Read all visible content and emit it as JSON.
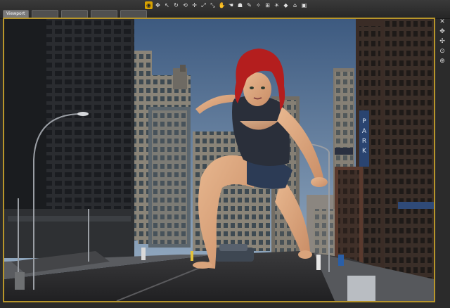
{
  "tabs": [
    {
      "label": "Viewport",
      "active": true
    },
    {
      "label": "",
      "active": false
    },
    {
      "label": "",
      "active": false
    },
    {
      "label": "",
      "active": false
    },
    {
      "label": "",
      "active": false
    }
  ],
  "toolbar": {
    "tools": [
      {
        "icon": "camera-select-icon",
        "glyph": "◉",
        "active": true
      },
      {
        "icon": "move-icon",
        "glyph": "✥"
      },
      {
        "icon": "pointer-icon",
        "glyph": "↖"
      },
      {
        "icon": "rotate-icon",
        "glyph": "↻"
      },
      {
        "icon": "orbit-icon",
        "glyph": "⟲"
      },
      {
        "icon": "translate-icon",
        "glyph": "✛"
      },
      {
        "icon": "scale-icon",
        "glyph": "⤢"
      },
      {
        "icon": "twist-icon",
        "glyph": "⤡"
      },
      {
        "icon": "hand-icon",
        "glyph": "✋"
      },
      {
        "icon": "grab-icon",
        "glyph": "☚"
      },
      {
        "icon": "figure-icon",
        "glyph": "☗"
      },
      {
        "icon": "brush-icon",
        "glyph": "✎"
      },
      {
        "icon": "morph-icon",
        "glyph": "✧"
      },
      {
        "icon": "node-icon",
        "glyph": "⊞"
      },
      {
        "icon": "light-icon",
        "glyph": "☀"
      },
      {
        "icon": "material-icon",
        "glyph": "◆"
      },
      {
        "icon": "render-icon",
        "glyph": "⌂"
      },
      {
        "icon": "snapshot-icon",
        "glyph": "▣"
      }
    ]
  },
  "sidetools": [
    {
      "icon": "close-icon",
      "glyph": "✕"
    },
    {
      "icon": "pan-icon",
      "glyph": "✥"
    },
    {
      "icon": "orbit-view-icon",
      "glyph": "✣"
    },
    {
      "icon": "zoom-icon",
      "glyph": "⊙"
    },
    {
      "icon": "frame-icon",
      "glyph": "⊕"
    }
  ],
  "scene": {
    "sign_text": "PARK",
    "colors": {
      "sky_top": "#3d5a80",
      "sky_bottom": "#9db3c8",
      "hair": "#b41e1e",
      "accent": "#d9a300",
      "viewport_border": "#b8962a"
    }
  }
}
